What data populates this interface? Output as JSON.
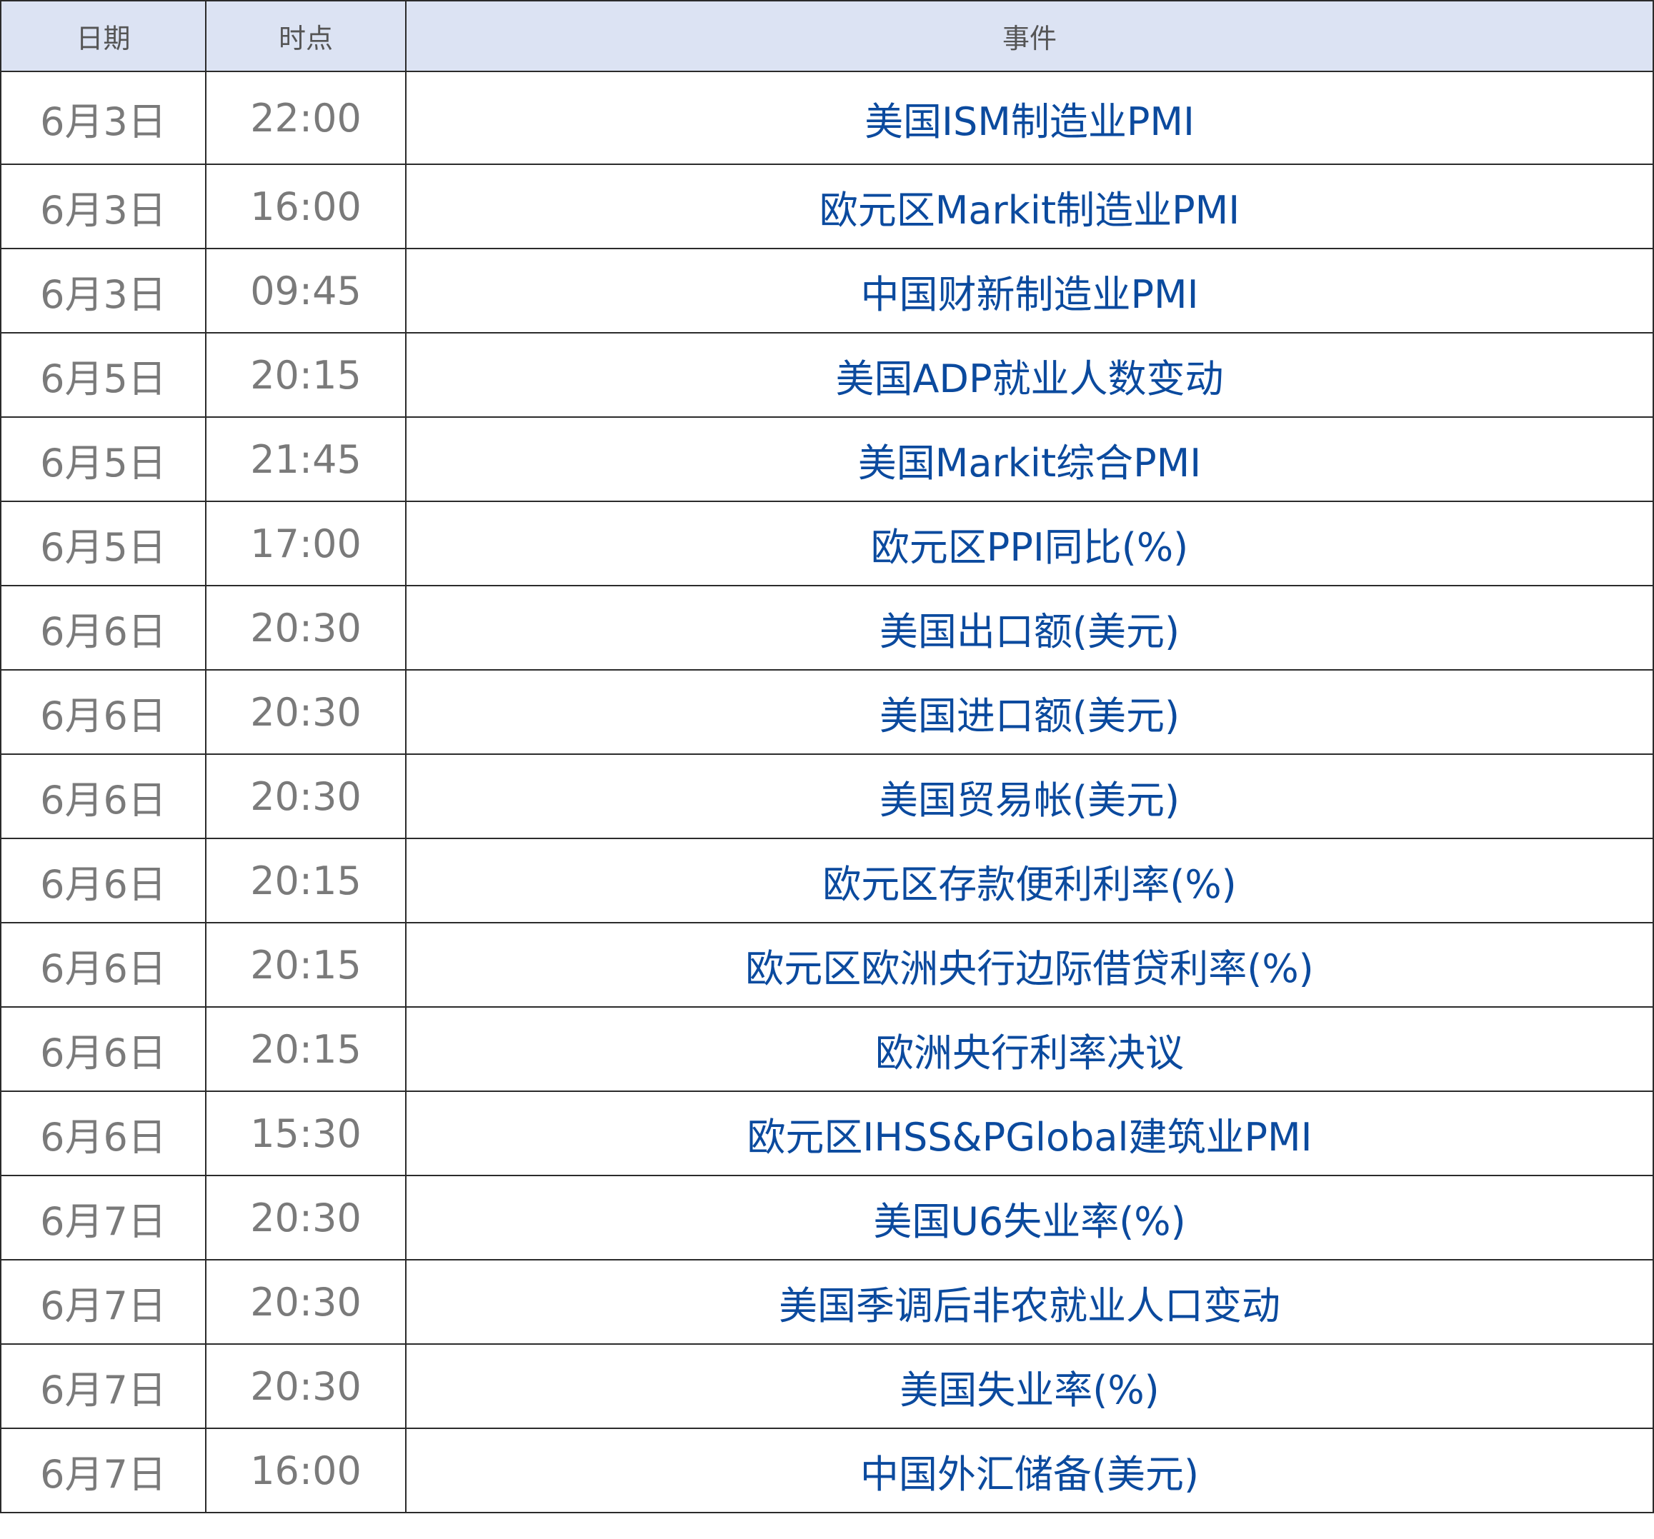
{
  "table": {
    "header": {
      "date": "日期",
      "time": "时点",
      "event": "事件"
    },
    "rows": [
      {
        "date": "6月3日",
        "time": "22:00",
        "event": "美国ISM制造业PMI"
      },
      {
        "date": "6月3日",
        "time": "16:00",
        "event": "欧元区Markit制造业PMI"
      },
      {
        "date": "6月3日",
        "time": "09:45",
        "event": "中国财新制造业PMI"
      },
      {
        "date": "6月5日",
        "time": "20:15",
        "event": "美国ADP就业人数变动"
      },
      {
        "date": "6月5日",
        "time": "21:45",
        "event": "美国Markit综合PMI"
      },
      {
        "date": "6月5日",
        "time": "17:00",
        "event": "欧元区PPI同比(%)"
      },
      {
        "date": "6月6日",
        "time": "20:30",
        "event": "美国出口额(美元)"
      },
      {
        "date": "6月6日",
        "time": "20:30",
        "event": "美国进口额(美元)"
      },
      {
        "date": "6月6日",
        "time": "20:30",
        "event": "美国贸易帐(美元)"
      },
      {
        "date": "6月6日",
        "time": "20:15",
        "event": "欧元区存款便利利率(%)"
      },
      {
        "date": "6月6日",
        "time": "20:15",
        "event": "欧元区欧洲央行边际借贷利率(%)"
      },
      {
        "date": "6月6日",
        "time": "20:15",
        "event": "欧洲央行利率决议"
      },
      {
        "date": "6月6日",
        "time": "15:30",
        "event": "欧元区IHSS&PGlobal建筑业PMI"
      },
      {
        "date": "6月7日",
        "time": "20:30",
        "event": "美国U6失业率(%)"
      },
      {
        "date": "6月7日",
        "time": "20:30",
        "event": "美国季调后非农就业人口变动"
      },
      {
        "date": "6月7日",
        "time": "20:30",
        "event": "美国失业率(%)"
      },
      {
        "date": "6月7日",
        "time": "16:00",
        "event": "中国外汇储备(美元)"
      }
    ]
  }
}
